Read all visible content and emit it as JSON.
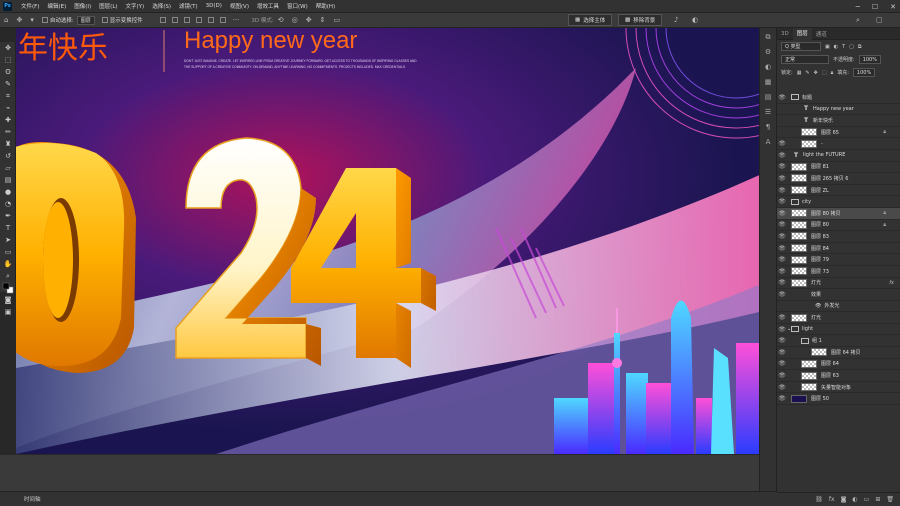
{
  "menu": {
    "items": [
      "文件(F)",
      "编辑(E)",
      "图像(I)",
      "图层(L)",
      "文字(Y)",
      "选择(S)",
      "滤镜(T)",
      "3D(D)",
      "视图(V)",
      "增效工具",
      "窗口(W)",
      "帮助(H)"
    ]
  },
  "options": {
    "auto_select": "自动选择:",
    "layer_target": "图层",
    "show_transform": "显示变换控件",
    "mode_3d": "3D 模式:",
    "select_subject": "选择主体",
    "remove_bg": "移除背景"
  },
  "artwork": {
    "title_cn": "年快乐",
    "title_en": "Happy new year",
    "fine_print_1": "DON'T JUST IMAGINE, CREATE. LET INSPIRED LINE FROM CREATIVE JOURNEY FORWARD. GET ACCESS TO THOUSANDS OF INSPIRING GLASSES AND",
    "fine_print_2": "THE SUPPORT OF A CREATIVE COMMUNITY. ON-DEMAND, ANYTIME LEARNING, NO COMMITMENTS. PROJECTS INCLUDED. MAX CREDENTIALS.",
    "digits": "024"
  },
  "layers_panel": {
    "tabs": [
      "3D",
      "图层",
      "通道"
    ],
    "filter_label": "Q 类型",
    "blend_mode": "正常",
    "opacity_label": "不透明度:",
    "opacity_value": "100%",
    "lock_label": "锁定:",
    "fill_label": "填充:",
    "fill_value": "100%",
    "layers": [
      {
        "name": "标题",
        "kind": "folder"
      },
      {
        "name": "Happy new year",
        "kind": "text"
      },
      {
        "name": "新年快乐",
        "kind": "text"
      },
      {
        "name": "图层 65",
        "kind": "pixel"
      },
      {
        "name": "-",
        "kind": "pixel"
      },
      {
        "name": "light the FUTURE",
        "kind": "text"
      },
      {
        "name": "图层 81",
        "kind": "pixel"
      },
      {
        "name": "图层 265 拷贝 6",
        "kind": "pixel"
      },
      {
        "name": "图层 ZL",
        "kind": "pixel"
      },
      {
        "name": "city",
        "kind": "folder"
      },
      {
        "name": "图层 80 拷贝",
        "kind": "pixel"
      },
      {
        "name": "图层 80",
        "kind": "pixel"
      },
      {
        "name": "图层 83",
        "kind": "pixel"
      },
      {
        "name": "图层 84",
        "kind": "pixel"
      },
      {
        "name": "图层 79",
        "kind": "pixel"
      },
      {
        "name": "图层 73",
        "kind": "pixel"
      },
      {
        "name": "灯光",
        "kind": "pixel"
      },
      {
        "name": "效果",
        "kind": "effect"
      },
      {
        "name": "外发光",
        "kind": "effect"
      },
      {
        "name": "灯光",
        "kind": "pixel"
      },
      {
        "name": "light",
        "kind": "folder"
      },
      {
        "name": "组 1",
        "kind": "folder"
      },
      {
        "name": "图层 64 拷贝",
        "kind": "pixel"
      },
      {
        "name": "图层 64",
        "kind": "pixel"
      },
      {
        "name": "图层 63",
        "kind": "pixel"
      },
      {
        "name": "矢量智能对象",
        "kind": "pixel"
      },
      {
        "name": "图层 50",
        "kind": "dark"
      }
    ]
  },
  "timeline": {
    "label": "时间轴"
  }
}
